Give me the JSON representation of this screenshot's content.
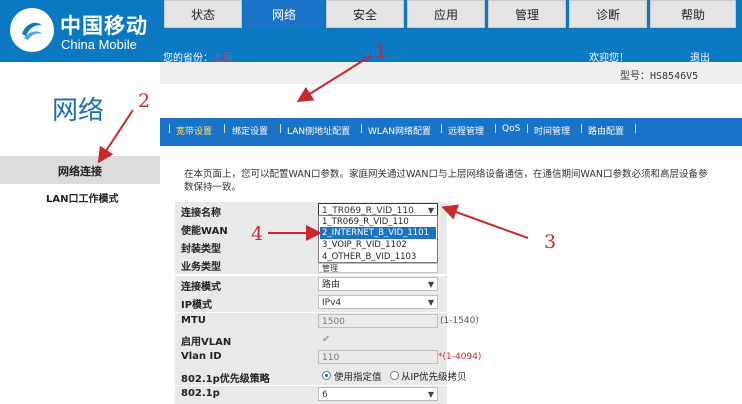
{
  "header": {
    "logo_cn": "中国移动",
    "logo_en": "China Mobile",
    "province_label": "您的省份：",
    "province_value": "上海",
    "welcome": "欢迎您！",
    "logout": "退出",
    "model": "型号：HS8546V5",
    "brand_color": "#0b78c2"
  },
  "sidebar": {
    "title": "网络",
    "items": [
      {
        "label": "网络连接",
        "active": true
      },
      {
        "label": "LAN口工作模式",
        "active": false
      }
    ]
  },
  "tabs": [
    {
      "label": "状态",
      "active": false
    },
    {
      "label": "网络",
      "active": true
    },
    {
      "label": "安全",
      "active": false
    },
    {
      "label": "应用",
      "active": false
    },
    {
      "label": "管理",
      "active": false
    },
    {
      "label": "诊断",
      "active": false
    },
    {
      "label": "帮助",
      "active": false
    }
  ],
  "subnav": [
    {
      "label": "宽带设置",
      "active": true
    },
    {
      "label": "绑定设置",
      "active": false
    },
    {
      "label": "LAN侧地址配置",
      "active": false
    },
    {
      "label": "WLAN网络配置",
      "active": false
    },
    {
      "label": "远程管理",
      "active": false
    },
    {
      "label": "QoS",
      "active": false
    },
    {
      "label": "时间管理",
      "active": false
    },
    {
      "label": "路由配置",
      "active": false
    }
  ],
  "description": "在本页面上，您可以配置WAN口参数。家庭网关通过WAN口与上层网络设备通信，在通信期间WAN口参数必须和高层设备参数保持一致。",
  "form": {
    "conn_name_label": "连接名称",
    "conn_name_value": "1_TR069_R_VID_110",
    "enable_wan_label": "使能WAN",
    "encap_label": "封装类型",
    "service_label": "业务类型",
    "service_value": "管理",
    "conn_mode_label": "连接模式",
    "conn_mode_value": "路由",
    "ip_mode_label": "IP模式",
    "ip_mode_value": "IPv4",
    "mtu_label": "MTU",
    "mtu_value": "1500",
    "mtu_hint": "(1-1540)",
    "vlan_enable_label": "启用VLAN",
    "vlan_enable_checked": true,
    "vlan_id_label": "Vlan ID",
    "vlan_id_value": "110",
    "vlan_id_hint": "*(1-4094)",
    "p8021_policy_label": "802.1p优先级策略",
    "p8021_policy_options": [
      "使用指定值",
      "从IP优先级拷贝"
    ],
    "p8021_policy_selected": "使用指定值",
    "p8021p_label": "802.1p",
    "p8021p_value": "6"
  },
  "dropdown_options": [
    {
      "label": "1_TR069_R_VID_110",
      "selected": false
    },
    {
      "label": "2_INTERNET_B_VID_1101",
      "selected": true
    },
    {
      "label": "3_VOIP_R_VID_1102",
      "selected": false
    },
    {
      "label": "4_OTHER_B_VID_1103",
      "selected": false
    }
  ],
  "annotations": [
    "1",
    "2",
    "3",
    "4"
  ],
  "annotation_color": "#c8282e",
  "accent_color": "#1a73c6"
}
